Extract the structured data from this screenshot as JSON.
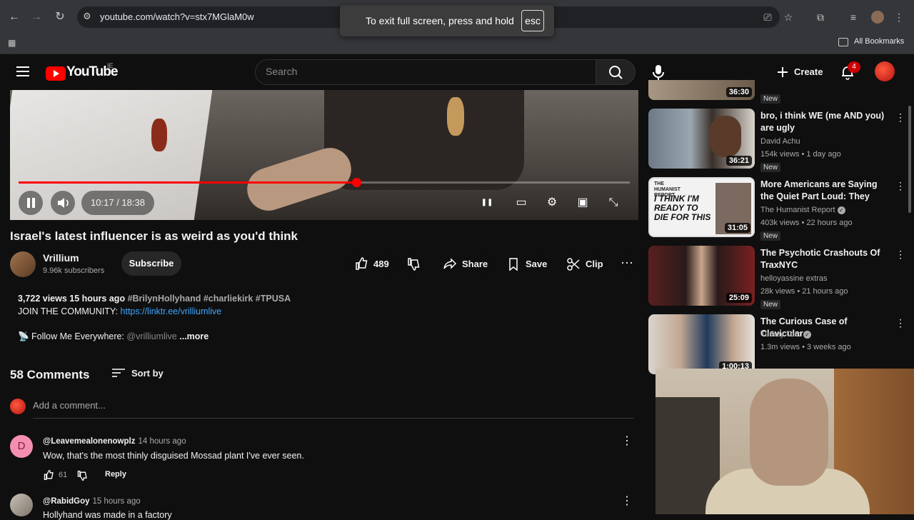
{
  "browser": {
    "url": "youtube.com/watch?v=stx7MGlaM0w",
    "fullscreen_toast": "To exit full screen, press and hold",
    "fullscreen_key": "esc",
    "bookmarks_label": "All Bookmarks"
  },
  "header": {
    "logo_text": "YouTube",
    "logo_region": "IE",
    "search_placeholder": "Search",
    "create_label": "Create",
    "notification_count": "4"
  },
  "player": {
    "time": "10:17 / 18:38",
    "progress_fraction": 0.552
  },
  "video": {
    "title": "Israel's latest influencer is as weird as you'd think",
    "channel_name": "Vrillium",
    "subscribers": "9.96k subscribers",
    "subscribe_label": "Subscribe",
    "likes": "489",
    "share_label": "Share",
    "save_label": "Save",
    "clip_label": "Clip"
  },
  "description": {
    "stats": "3,722 views  15 hours ago",
    "tags": "#BrilynHollyhand #charliekirk #TPUSA",
    "join_text": "JOIN THE COMMUNITY: ",
    "join_link": "https://linktr.ee/vrilliumlive",
    "follow_text": "📡 Follow Me Everywhere: ",
    "follow_handle": "@vrilliumlive",
    "more_label": "...more"
  },
  "comments": {
    "count_label": "58 Comments",
    "sort_label": "Sort by",
    "add_placeholder": "Add a comment...",
    "items": [
      {
        "avatar_letter": "D",
        "author": "@Leavemealonenowplz",
        "time": "14 hours ago",
        "text": "Wow, that's the most thinly disguised Mossad plant I've ever seen.",
        "likes": "61",
        "reply_label": "Reply"
      },
      {
        "avatar_letter": "",
        "author": "@RabidGoy",
        "time": "15 hours ago",
        "text": "Hollyhand was made in a factory",
        "likes": "",
        "reply_label": ""
      }
    ]
  },
  "sidebar": {
    "partial_top": {
      "duration": "36:30",
      "badge": "New"
    },
    "items": [
      {
        "title": "bro, i think WE (me AND you) are ugly",
        "channel": "David Achu",
        "verified": false,
        "meta": "154k views • 1 day ago",
        "badge": "New",
        "duration": "36:21"
      },
      {
        "title": "More Americans are Saying the Quiet Part Loud: They Want a ...",
        "channel": "The Humanist Report",
        "verified": true,
        "meta": "403k views • 22 hours ago",
        "badge": "New",
        "duration": "31:05",
        "thumb_text": "I THINK I'M READY TO DIE FOR THIS",
        "thumb_brand": "THE HUMANIST REPORT"
      },
      {
        "title": "The Psychotic Crashouts Of TraxNYC",
        "channel": "helloyassine extras",
        "verified": false,
        "meta": "28k views • 21 hours ago",
        "badge": "New",
        "duration": "25:09"
      },
      {
        "title": "The Curious Case of Clavicular",
        "channel": "Turkey Tom",
        "verified": true,
        "meta": "1.3m views • 3 weeks ago",
        "badge": "",
        "duration": "1:00:13"
      }
    ]
  },
  "colors": {
    "background": "#0f0f0f",
    "accent_red": "#ff0000",
    "link_blue": "#3ea6ff",
    "muted_text": "#aaaaaa"
  }
}
